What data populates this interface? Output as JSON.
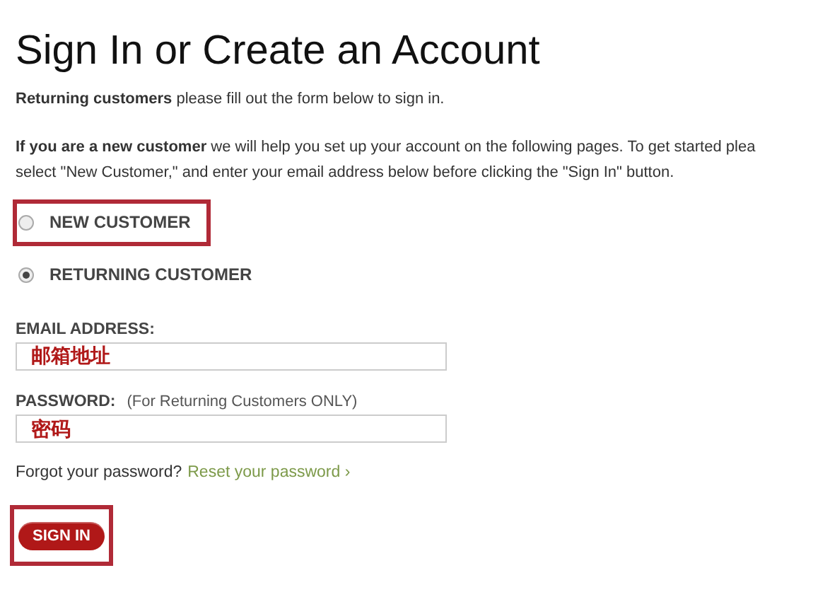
{
  "title": "Sign In or Create an Account",
  "intro": "**Returning customers** please fill out the form below to sign in.",
  "new_customer_info": [
    "**If you are a new customer** we will help you set up your account on the following pages. To get started plea",
    "select \"New Customer,\" and enter your email address below before clicking the \"Sign In\" button."
  ],
  "customer_type": [
    {
      "label": "NEW CUSTOMER",
      "selected": false,
      "highlighted": true
    },
    {
      "label": "RETURNING CUSTOMER",
      "selected": true,
      "highlighted": false
    }
  ],
  "fields": [
    {
      "label": "EMAIL ADDRESS:",
      "value": "邮箱地址"
    },
    {
      "label": "PASSWORD:",
      "note": "(For Returning Customers ONLY)",
      "value": "密码"
    }
  ],
  "forgot": {
    "text": "Forgot your password?",
    "link": "Reset your password ›"
  },
  "sign_in_button": {
    "label": "SIGN IN",
    "highlighted": true
  }
}
